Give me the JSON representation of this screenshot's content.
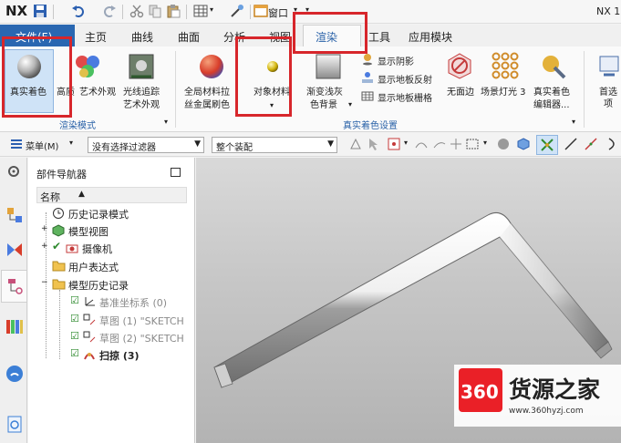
{
  "titlebar": {
    "logo": "NX",
    "window_menu": "窗口",
    "title_fragment": "NX 1"
  },
  "tabs": [
    "文件(F)",
    "主页",
    "曲线",
    "曲面",
    "分析",
    "视图",
    "渲染",
    "工具",
    "应用模块"
  ],
  "ribbon": {
    "render_mode": {
      "true_shading": "真实着色",
      "hq_art_1": "高质",
      "hq_art_2": "艺术外观",
      "ray_1": "光线追踪",
      "ray_2": "艺术外观",
      "group": "渲染模式"
    },
    "material": {
      "global_1": "全局材料拉",
      "global_2": "丝金属刷色",
      "object": "对象材料"
    },
    "settings": {
      "gradient_1": "渐变浅灰",
      "gradient_2": "色背景",
      "show_shadow": "显示阴影",
      "floor_reflect": "显示地板反射",
      "floor_grid": "显示地板栅格",
      "no_background": "无面边",
      "scene_light": "场景灯光 3",
      "editor_1": "真实着色",
      "editor_2": "编辑器...",
      "group": "真实着色设置"
    },
    "prefs": "首选项"
  },
  "toolbar": {
    "menu": "菜单(M)",
    "filter": "没有选择过滤器",
    "assembly": "整个装配"
  },
  "navigator": {
    "title": "部件导航器",
    "column": "名称",
    "items": {
      "history_mode": "历史记录模式",
      "model_views": "模型视图",
      "camera": "摄像机",
      "user_expressions": "用户表达式",
      "model_history": "模型历史记录",
      "datum_csys": "基准坐标系 (0)",
      "sketch1": "草图 (1) \"SKETCH",
      "sketch2": "草图 (2) \"SKETCH",
      "sweep": "扫掠 (3)"
    }
  },
  "watermark": {
    "badge": "360",
    "brand": "货源之家",
    "url": "www.360hyzj.com"
  },
  "colors": {
    "file_tab": "#2a67b1",
    "highlight": "#d7262b",
    "watermark_red": "#ea2027"
  }
}
